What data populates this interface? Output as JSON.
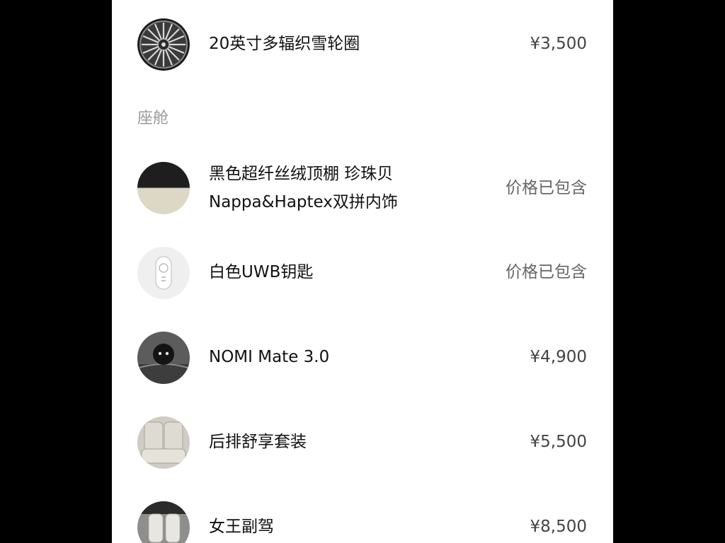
{
  "section": {
    "cabin_label": "座舱"
  },
  "items": [
    {
      "name": "20英寸多辐织雪轮圈",
      "price": "¥3,500",
      "icon": "wheel-rim-icon"
    },
    {
      "name_line1": "黑色超纤丝绒顶棚 珍珠贝",
      "name_line2": "Nappa&Haptex双拼内饰",
      "price": "价格已包含",
      "icon": "interior-swatch-icon"
    },
    {
      "name": "白色UWB钥匙",
      "price": "价格已包含",
      "icon": "uwb-key-icon"
    },
    {
      "name": "NOMI Mate 3.0",
      "price": "¥4,900",
      "icon": "nomi-mate-icon"
    },
    {
      "name": "后排舒享套装",
      "price": "¥5,500",
      "icon": "rear-seat-icon"
    },
    {
      "name": "女王副驾",
      "price": "¥8,500",
      "icon": "queen-seat-icon"
    }
  ],
  "colors": {
    "background": "#000000",
    "panel": "#ffffff",
    "text": "#111111",
    "price": "#444444",
    "section_label": "#9a9a9a"
  }
}
